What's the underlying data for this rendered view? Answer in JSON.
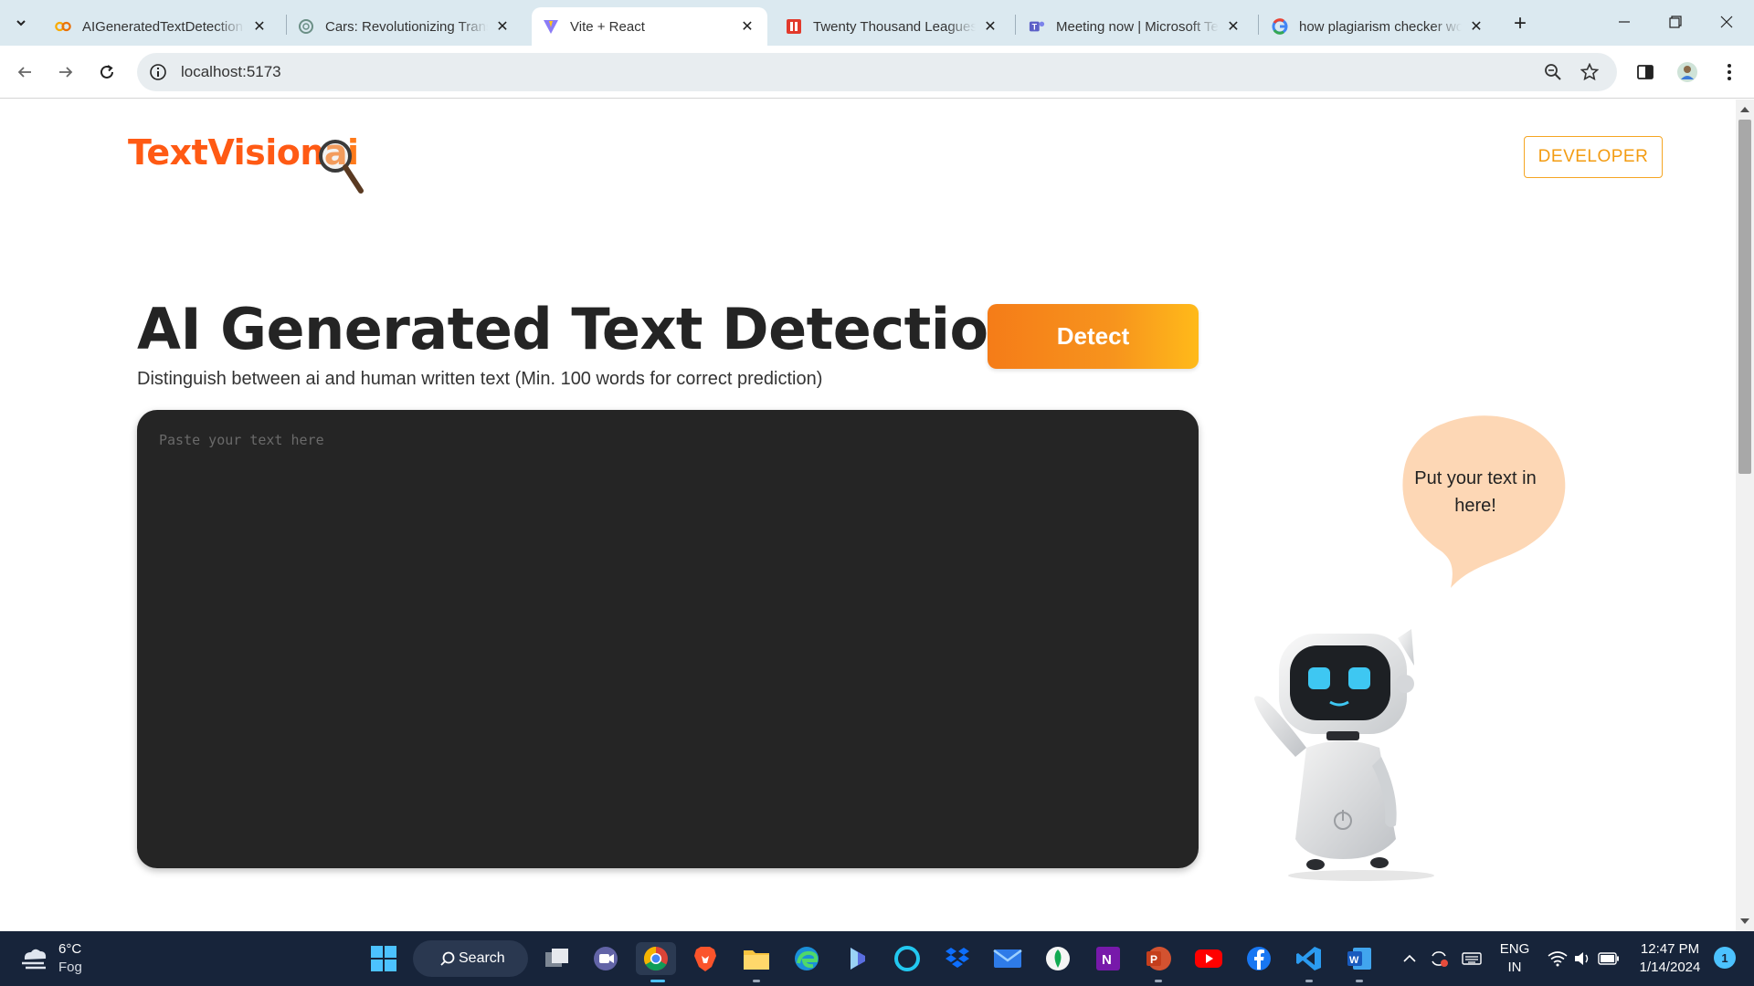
{
  "browser": {
    "tabs": [
      {
        "title": "AIGeneratedTextDetection",
        "favicon": "colab-icon",
        "active": false
      },
      {
        "title": "Cars: Revolutionizing Transportation",
        "favicon": "chatgpt-icon",
        "active": false
      },
      {
        "title": "Vite + React",
        "favicon": "vite-icon",
        "active": true
      },
      {
        "title": "Twenty Thousand Leagues",
        "favicon": "book-icon",
        "active": false
      },
      {
        "title": "Meeting now | Microsoft Teams",
        "favicon": "teams-icon",
        "active": false
      },
      {
        "title": "how plagiarism checker works",
        "favicon": "google-icon",
        "active": false
      }
    ],
    "address": "localhost:5173"
  },
  "page": {
    "logo": {
      "main": "TextVision",
      "tail": "ai"
    },
    "developer_button": "DEVELOPER",
    "title": "AI Generated Text Detection",
    "subtitle": "Distinguish between ai and human written text (Min. 100 words for correct prediction)",
    "detect_button": "Detect",
    "textarea_placeholder": "Paste your text here",
    "bubble_text": "Put your text in here!",
    "accent_color": "#f7941d"
  },
  "taskbar": {
    "weather": {
      "temp": "6°C",
      "condition": "Fog"
    },
    "search_label": "Search",
    "language": {
      "line1": "ENG",
      "line2": "IN"
    },
    "clock": {
      "time": "12:47 PM",
      "date": "1/14/2024"
    },
    "notification_count": "1"
  }
}
